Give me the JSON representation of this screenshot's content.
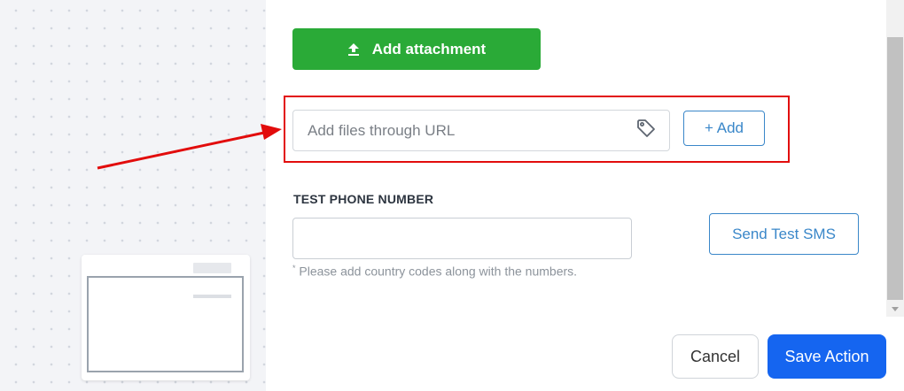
{
  "attachment": {
    "label": "Add attachment",
    "icon": "upload-icon"
  },
  "url_field": {
    "placeholder": "Add files through URL",
    "value": "",
    "icon": "tag-icon"
  },
  "add_button": {
    "label": "+ Add"
  },
  "test_phone": {
    "label": "TEST PHONE NUMBER",
    "value": "",
    "hint_mark": "*",
    "hint": "Please add country codes along with the numbers."
  },
  "send_test_sms": {
    "label": "Send Test SMS"
  },
  "footer": {
    "cancel_label": "Cancel",
    "save_label": "Save Action"
  },
  "annotation": {
    "highlight_color": "#e20c0c"
  },
  "colors": {
    "green": "#2aaa37",
    "blue": "#1565f0",
    "outline_blue": "#3a87c9"
  }
}
